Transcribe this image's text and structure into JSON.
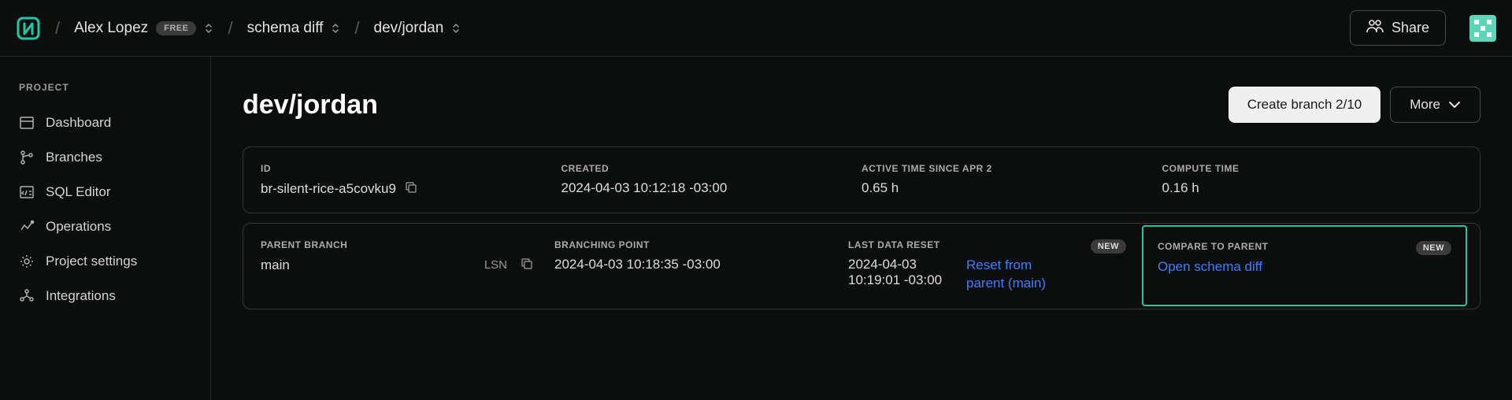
{
  "breadcrumb": {
    "user": "Alex Lopez",
    "tier_badge": "FREE",
    "project": "schema diff",
    "branch": "dev/jordan"
  },
  "topbar": {
    "share": "Share"
  },
  "sidebar": {
    "heading": "PROJECT",
    "items": [
      {
        "label": "Dashboard"
      },
      {
        "label": "Branches"
      },
      {
        "label": "SQL Editor"
      },
      {
        "label": "Operations"
      },
      {
        "label": "Project settings"
      },
      {
        "label": "Integrations"
      }
    ]
  },
  "page": {
    "title": "dev/jordan",
    "create_branch": "Create branch 2/10",
    "more": "More"
  },
  "card1": {
    "id_label": "ID",
    "id_value": "br-silent-rice-a5covku9",
    "created_label": "CREATED",
    "created_value": "2024-04-03 10:12:18 -03:00",
    "active_label": "ACTIVE TIME SINCE APR 2",
    "active_value": "0.65 h",
    "compute_label": "COMPUTE TIME",
    "compute_value": "0.16 h"
  },
  "card2": {
    "parent_label": "PARENT BRANCH",
    "parent_value": "main",
    "lsn": "LSN",
    "branching_label": "BRANCHING POINT",
    "branching_value": "2024-04-03 10:18:35 -03:00",
    "reset_label": "LAST DATA RESET",
    "reset_value": "2024-04-03 10:19:01 -03:00",
    "reset_action": "Reset from parent (main)",
    "reset_badge": "NEW",
    "compare_label": "COMPARE TO PARENT",
    "compare_action": "Open schema diff",
    "compare_badge": "NEW"
  }
}
